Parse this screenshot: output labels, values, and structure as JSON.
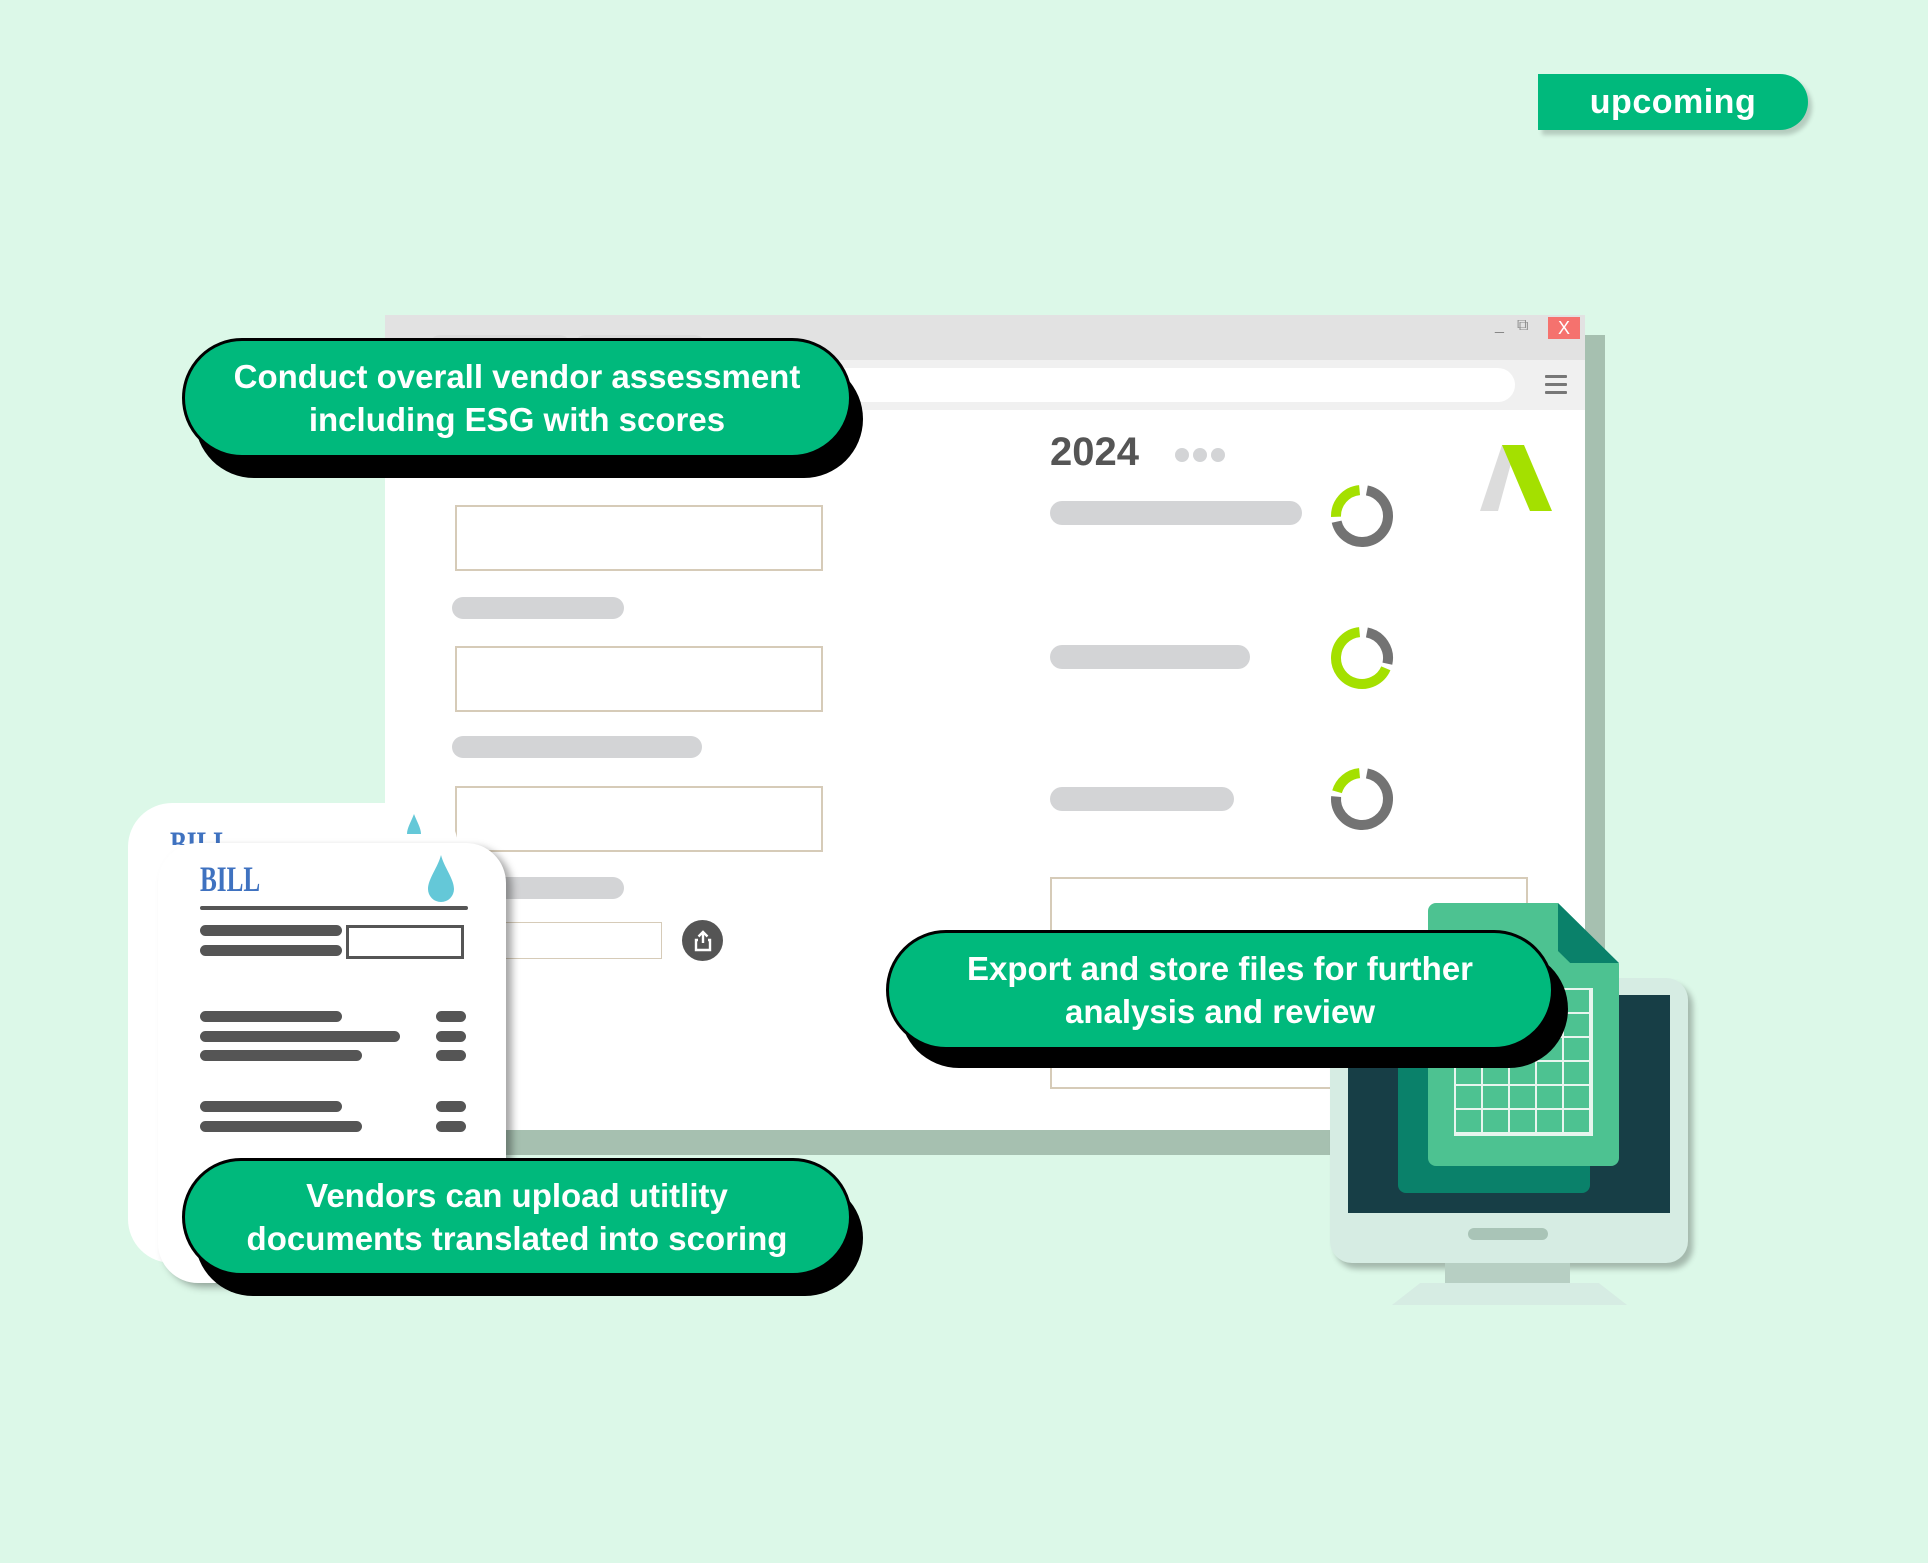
{
  "badge": {
    "label": "upcoming"
  },
  "browser": {
    "controls": {
      "minimize": "_",
      "restore": "⧉",
      "close": "X"
    },
    "menu_icon": "hamburger-menu-icon",
    "content": {
      "year": "2024",
      "scores": [
        {
          "green_fraction": 0.27
        },
        {
          "green_fraction": 0.7
        },
        {
          "green_fraction": 0.22
        }
      ]
    }
  },
  "callouts": {
    "assessment": {
      "line1": "Conduct overall vendor assessment",
      "line2": "including ESG with scores"
    },
    "export": {
      "line1": "Export and store files for further",
      "line2": "analysis and review"
    },
    "upload": {
      "line1": "Vendors can upload utitlity",
      "line2": "documents translated into scoring"
    }
  },
  "bill": {
    "title": "BILL",
    "title_back": "BILL"
  },
  "colors": {
    "accent": "#00b97c",
    "score_green": "#a4e000",
    "score_gray": "#737373",
    "background": "#dcf8e8"
  }
}
